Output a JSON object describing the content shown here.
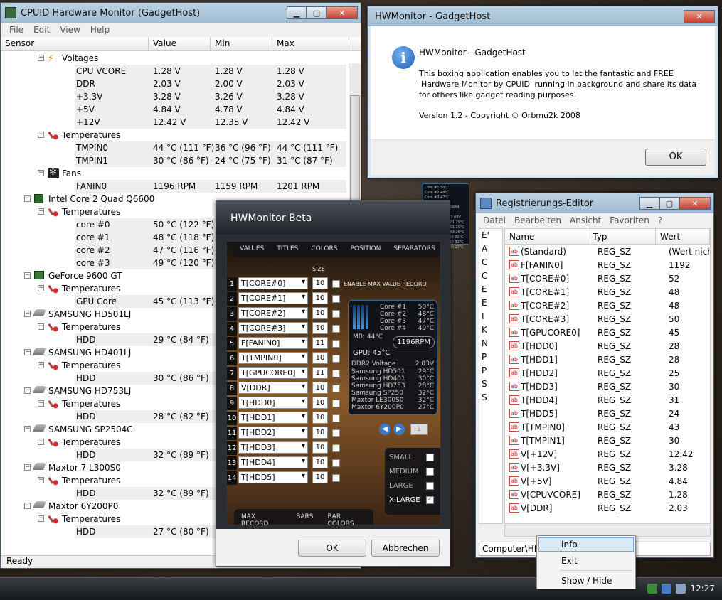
{
  "cpuid": {
    "title": "CPUID Hardware Monitor (GadgetHost)",
    "menu": [
      "File",
      "Edit",
      "View",
      "Help"
    ],
    "columns": [
      "Sensor",
      "Value",
      "Min",
      "Max"
    ],
    "status": "Ready",
    "rows": [
      {
        "indent": 3,
        "icon": "volt",
        "label": "Voltages",
        "group": true
      },
      {
        "indent": 4,
        "label": "CPU VCORE",
        "value": "1.28 V",
        "min": "1.28 V",
        "max": "1.28 V"
      },
      {
        "indent": 4,
        "label": "DDR",
        "value": "2.03 V",
        "min": "2.00 V",
        "max": "2.03 V"
      },
      {
        "indent": 4,
        "label": "+3.3V",
        "value": "3.28 V",
        "min": "3.26 V",
        "max": "3.28 V"
      },
      {
        "indent": 4,
        "label": "+5V",
        "value": "4.84 V",
        "min": "4.78 V",
        "max": "4.84 V"
      },
      {
        "indent": 4,
        "label": "+12V",
        "value": "12.42 V",
        "min": "12.35 V",
        "max": "12.42 V"
      },
      {
        "indent": 3,
        "icon": "therm",
        "label": "Temperatures",
        "group": true
      },
      {
        "indent": 5,
        "label": "TMPIN0",
        "value": "44 °C  (111 °F)",
        "min": "36 °C  (96 °F)",
        "max": "44 °C  (111 °F)"
      },
      {
        "indent": 5,
        "label": "TMPIN1",
        "value": "30 °C  (86 °F)",
        "min": "24 °C  (75 °F)",
        "max": "31 °C  (87 °F)"
      },
      {
        "indent": 3,
        "icon": "fan",
        "label": "Fans",
        "group": true
      },
      {
        "indent": 5,
        "label": "FANIN0",
        "value": "1196 RPM",
        "min": "1159 RPM",
        "max": "1201 RPM"
      },
      {
        "indent": 2,
        "icon": "chip",
        "label": "Intel Core 2 Quad Q6600",
        "group": true
      },
      {
        "indent": 3,
        "icon": "therm",
        "label": "Temperatures",
        "group": true
      },
      {
        "indent": 4,
        "label": "core #0",
        "value": "50 °C  (122 °F)"
      },
      {
        "indent": 4,
        "label": "core #1",
        "value": "48 °C  (118 °F)"
      },
      {
        "indent": 4,
        "label": "core #2",
        "value": "47 °C  (116 °F)"
      },
      {
        "indent": 4,
        "label": "core #3",
        "value": "49 °C  (120 °F)"
      },
      {
        "indent": 2,
        "icon": "gpu",
        "label": "GeForce 9600 GT",
        "group": true
      },
      {
        "indent": 3,
        "icon": "therm",
        "label": "Temperatures",
        "group": true
      },
      {
        "indent": 4,
        "label": "GPU Core",
        "value": "45 °C  (113 °F)"
      },
      {
        "indent": 2,
        "icon": "disk",
        "label": "SAMSUNG HD501LJ",
        "group": true
      },
      {
        "indent": 3,
        "icon": "therm",
        "label": "Temperatures",
        "group": true
      },
      {
        "indent": 4,
        "label": "HDD",
        "value": "29 °C  (84 °F)"
      },
      {
        "indent": 2,
        "icon": "disk",
        "label": "SAMSUNG HD401LJ",
        "group": true
      },
      {
        "indent": 3,
        "icon": "therm",
        "label": "Temperatures",
        "group": true
      },
      {
        "indent": 4,
        "label": "HDD",
        "value": "30 °C  (86 °F)"
      },
      {
        "indent": 2,
        "icon": "disk",
        "label": "SAMSUNG HD753LJ",
        "group": true
      },
      {
        "indent": 3,
        "icon": "therm",
        "label": "Temperatures",
        "group": true
      },
      {
        "indent": 4,
        "label": "HDD",
        "value": "28 °C  (82 °F)"
      },
      {
        "indent": 2,
        "icon": "disk",
        "label": "SAMSUNG SP2504C",
        "group": true
      },
      {
        "indent": 3,
        "icon": "therm",
        "label": "Temperatures",
        "group": true
      },
      {
        "indent": 4,
        "label": "HDD",
        "value": "32 °C  (89 °F)"
      },
      {
        "indent": 2,
        "icon": "disk",
        "label": "Maxtor 7 L300S0",
        "group": true
      },
      {
        "indent": 3,
        "icon": "therm",
        "label": "Temperatures",
        "group": true
      },
      {
        "indent": 4,
        "label": "HDD",
        "value": "32 °C  (89 °F)"
      },
      {
        "indent": 2,
        "icon": "disk",
        "label": "Maxtor 6Y200P0",
        "group": true
      },
      {
        "indent": 3,
        "icon": "therm",
        "label": "Temperatures",
        "group": true
      },
      {
        "indent": 4,
        "label": "HDD",
        "value": "27 °C  (80 °F)"
      }
    ]
  },
  "about": {
    "title": "HWMonitor - GadgetHost",
    "heading": "HWMonitor - GadgetHost",
    "line1": "This boxing application enables you to let the fantastic and FREE",
    "line2": "'Hardware Monitor by CPUID' running in background and share its data",
    "line3": "for others like gadget reading purposes.",
    "version": "Version 1.2 - Copyright © Orbmu2k 2008",
    "ok": "OK"
  },
  "registry": {
    "title": "Registrierungs-Editor",
    "menu": [
      "Datei",
      "Bearbeiten",
      "Ansicht",
      "Favoriten",
      "?"
    ],
    "columns": [
      "Name",
      "Typ",
      "Wert"
    ],
    "left_letters": [
      "E'",
      "A",
      "C",
      "C",
      "E",
      "E",
      "I",
      "K",
      "N",
      "P",
      "P",
      "S",
      "S"
    ],
    "rows": [
      {
        "name": "(Standard)",
        "type": "REG_SZ",
        "value": "(Wert nicht"
      },
      {
        "name": "F[FANIN0]",
        "type": "REG_SZ",
        "value": "1192"
      },
      {
        "name": "T[CORE#0]",
        "type": "REG_SZ",
        "value": "52"
      },
      {
        "name": "T[CORE#1]",
        "type": "REG_SZ",
        "value": "48"
      },
      {
        "name": "T[CORE#2]",
        "type": "REG_SZ",
        "value": "48"
      },
      {
        "name": "T[CORE#3]",
        "type": "REG_SZ",
        "value": "50"
      },
      {
        "name": "T[GPUCORE0]",
        "type": "REG_SZ",
        "value": "45"
      },
      {
        "name": "T[HDD0]",
        "type": "REG_SZ",
        "value": "28"
      },
      {
        "name": "T[HDD1]",
        "type": "REG_SZ",
        "value": "28"
      },
      {
        "name": "T[HDD2]",
        "type": "REG_SZ",
        "value": "25"
      },
      {
        "name": "T[HDD3]",
        "type": "REG_SZ",
        "value": "30"
      },
      {
        "name": "T[HDD4]",
        "type": "REG_SZ",
        "value": "31"
      },
      {
        "name": "T[HDD5]",
        "type": "REG_SZ",
        "value": "24"
      },
      {
        "name": "T[TMPIN0]",
        "type": "REG_SZ",
        "value": "43"
      },
      {
        "name": "T[TMPIN1]",
        "type": "REG_SZ",
        "value": "30"
      },
      {
        "name": "V[+12V]",
        "type": "REG_SZ",
        "value": "12.42"
      },
      {
        "name": "V[+3.3V]",
        "type": "REG_SZ",
        "value": "3.28"
      },
      {
        "name": "V[+5V]",
        "type": "REG_SZ",
        "value": "4.84"
      },
      {
        "name": "V[CPUVCORE]",
        "type": "REG_SZ",
        "value": "1.28"
      },
      {
        "name": "V[DDR]",
        "type": "REG_SZ",
        "value": "2.03"
      }
    ],
    "status": "Computer\\HKI                              re\\CPUID\\HWM"
  },
  "beta": {
    "title": "HWMonitor Beta",
    "tabs": [
      "VALUES",
      "TITLES",
      "COLORS",
      "POSITION",
      "SEPARATORS"
    ],
    "size_label": "SIZE",
    "max_label": "ENABLE MAX VALUE RECORD",
    "rows": [
      {
        "n": "1",
        "sel": "T[CORE#0]",
        "size": "10"
      },
      {
        "n": "2",
        "sel": "T[CORE#1]",
        "size": "10"
      },
      {
        "n": "3",
        "sel": "T[CORE#2]",
        "size": "10"
      },
      {
        "n": "4",
        "sel": "T[CORE#3]",
        "size": "10"
      },
      {
        "n": "5",
        "sel": "F[FANIN0]",
        "size": "11"
      },
      {
        "n": "6",
        "sel": "T[TMPIN0]",
        "size": "10"
      },
      {
        "n": "7",
        "sel": "T[GPUCORE0]",
        "size": "11"
      },
      {
        "n": "8",
        "sel": "V[DDR]",
        "size": "10"
      },
      {
        "n": "9",
        "sel": "T[HDD0]",
        "size": "10"
      },
      {
        "n": "10",
        "sel": "T[HDD1]",
        "size": "10"
      },
      {
        "n": "11",
        "sel": "T[HDD2]",
        "size": "10"
      },
      {
        "n": "12",
        "sel": "T[HDD3]",
        "size": "10"
      },
      {
        "n": "13",
        "sel": "T[HDD4]",
        "size": "10"
      },
      {
        "n": "14",
        "sel": "T[HDD5]",
        "size": "10"
      }
    ],
    "gadget": {
      "cores": [
        [
          "Core #1",
          "50°C"
        ],
        [
          "Core #2",
          "48°C"
        ],
        [
          "Core #3",
          "47°C"
        ],
        [
          "Core #4",
          "49°C"
        ]
      ],
      "mb": "MB:",
      "mb_val": "44°C",
      "rpm": "1196RPM",
      "gpu": "GPU:  45°C",
      "lines": [
        [
          "DDR2 Voltage",
          "2.03V"
        ],
        [
          "Samsung HD501",
          "29°C"
        ],
        [
          "Samsung HD401",
          "30°C"
        ],
        [
          "Samsung HD753",
          "28°C"
        ],
        [
          "Samsung SP250",
          "32°C"
        ],
        [
          "Maxtor LE300S0",
          "32°C"
        ],
        [
          "Maxtor 6Y200P0",
          "27°C"
        ]
      ]
    },
    "page": "1",
    "sizes": [
      "SMALL",
      "MEDIUM",
      "LARGE",
      "X-LARGE"
    ],
    "bottom_tabs": [
      "MAX RECORD",
      "BARS",
      "BAR COLORS"
    ],
    "ok": "OK",
    "cancel": "Abbrechen"
  },
  "mini": {
    "lines": [
      "Core #1  50°C",
      "Core #2  48°C",
      "Core #3  47°C",
      "Core #4  49°C",
      "MB:  44°C  1196RPM",
      "GPU: 45°C",
      "DDR2 Voltage  2.03V",
      "Samsung HD501  29°C",
      "Samsung HD401  30°C",
      "Samsung HD753  28°C",
      "Samsung SP250  32°C",
      "Maxtor LE300S0  32°C",
      "Maxtor 6Y200P0  27°C"
    ]
  },
  "context_menu": [
    "Info",
    "Exit",
    "Show / Hide"
  ],
  "clock": "12:27"
}
